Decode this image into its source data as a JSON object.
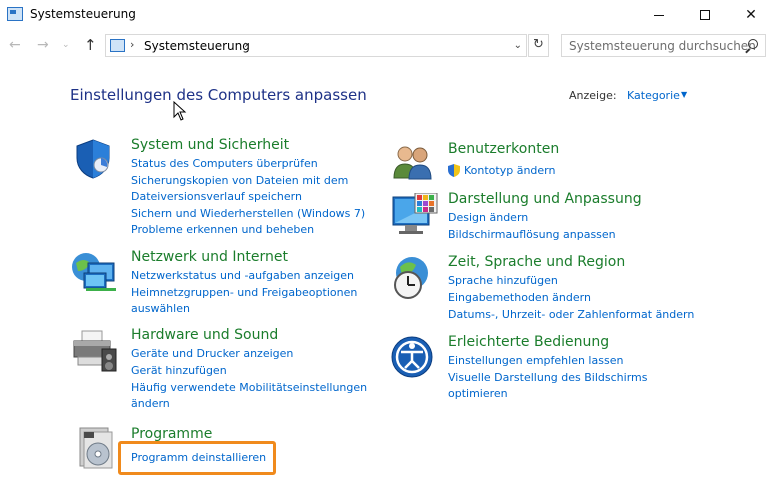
{
  "window": {
    "title": "Systemsteuerung",
    "min_icon": "minimize-icon",
    "max_icon": "maximize-icon",
    "close_glyph": "✕"
  },
  "nav": {
    "back_glyph": "←",
    "forward_glyph": "→",
    "recent_glyph": "⌄",
    "up_glyph": "↑",
    "breadcrumb": "Systemsteuerung",
    "breadcrumb_sep": "›",
    "dropdown_glyph": "⌄",
    "refresh_glyph": "↻",
    "search_placeholder": "Systemsteuerung durchsuchen"
  },
  "header": {
    "title": "Einstellungen des Computers anpassen",
    "view_label": "Anzeige:",
    "view_value": "Kategorie",
    "view_arrow": "▼"
  },
  "colors": {
    "category_title": "#1b7d2c",
    "link": "#0066cc",
    "heading": "#1e3287",
    "highlight": "#f08a1c"
  },
  "categories": {
    "system": {
      "title": "System und Sicherheit",
      "icon": "shield-icon",
      "links": [
        "Status des Computers überprüfen",
        "Sicherungskopien von Dateien mit dem",
        "Dateiversionsverlauf speichern",
        "Sichern und Wiederherstellen (Windows 7)",
        "Probleme erkennen und beheben"
      ]
    },
    "network": {
      "title": "Netzwerk und Internet",
      "icon": "network-icon",
      "links": [
        "Netzwerkstatus und -aufgaben anzeigen",
        "Heimnetzgruppen- und Freigabeoptionen",
        "auswählen"
      ]
    },
    "hardware": {
      "title": "Hardware und Sound",
      "icon": "printer-icon",
      "links": [
        "Geräte und Drucker anzeigen",
        "Gerät hinzufügen",
        "Häufig verwendete Mobilitätseinstellungen",
        "ändern"
      ]
    },
    "programs": {
      "title": "Programme",
      "icon": "programs-icon",
      "links": [
        "Programm deinstallieren"
      ]
    },
    "users": {
      "title": "Benutzerkonten",
      "icon": "users-icon",
      "links": [
        "Kontotyp ändern"
      ]
    },
    "appearance": {
      "title": "Darstellung und Anpassung",
      "icon": "display-icon",
      "links": [
        "Design ändern",
        "Bildschirmauflösung anpassen"
      ]
    },
    "region": {
      "title": "Zeit, Sprache und Region",
      "icon": "clock-globe-icon",
      "links": [
        "Sprache hinzufügen",
        "Eingabemethoden ändern",
        "Datums-, Uhrzeit- oder Zahlenformat ändern"
      ]
    },
    "access": {
      "title": "Erleichterte Bedienung",
      "icon": "accessibility-icon",
      "links": [
        "Einstellungen empfehlen lassen",
        "Visuelle Darstellung des Bildschirms",
        "optimieren"
      ]
    }
  }
}
